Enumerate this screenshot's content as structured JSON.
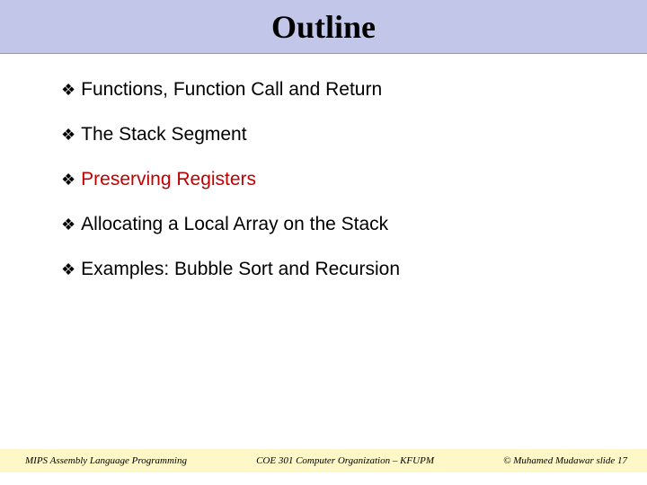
{
  "title": "Outline",
  "bullets": [
    {
      "text": "Functions, Function Call and Return",
      "highlight": false
    },
    {
      "text": "The Stack Segment",
      "highlight": false
    },
    {
      "text": "Preserving Registers",
      "highlight": true
    },
    {
      "text": "Allocating a Local Array on the Stack",
      "highlight": false
    },
    {
      "text": "Examples: Bubble Sort and Recursion",
      "highlight": false
    }
  ],
  "footer": {
    "left": "MIPS Assembly Language Programming",
    "center": "COE 301 Computer Organization – KFUPM",
    "right": "© Muhamed Mudawar   slide 17"
  }
}
